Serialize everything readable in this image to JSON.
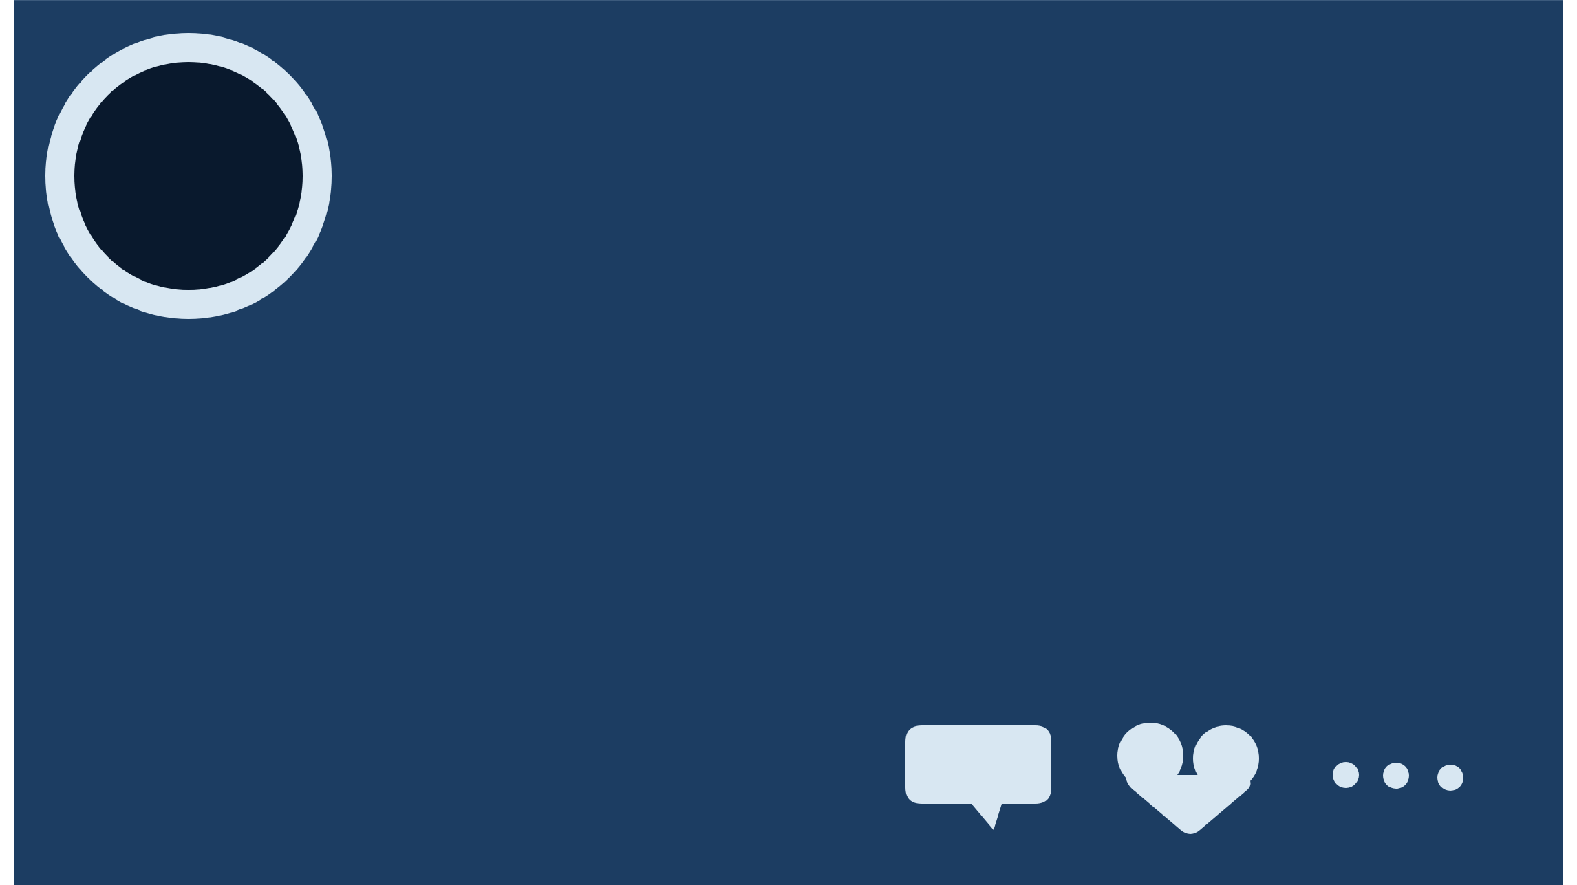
{
  "post_card": {
    "background_color": "#1c3d62",
    "avatar": {
      "ring_color": "#d8e7f2",
      "fill_color": "#09192d"
    },
    "actions": [
      {
        "id": "comment",
        "icon": "speech-bubble-icon"
      },
      {
        "id": "like",
        "icon": "heart-icon"
      },
      {
        "id": "more",
        "icon": "more-dots-icon"
      }
    ],
    "icon_color": "#d8e7f2"
  }
}
